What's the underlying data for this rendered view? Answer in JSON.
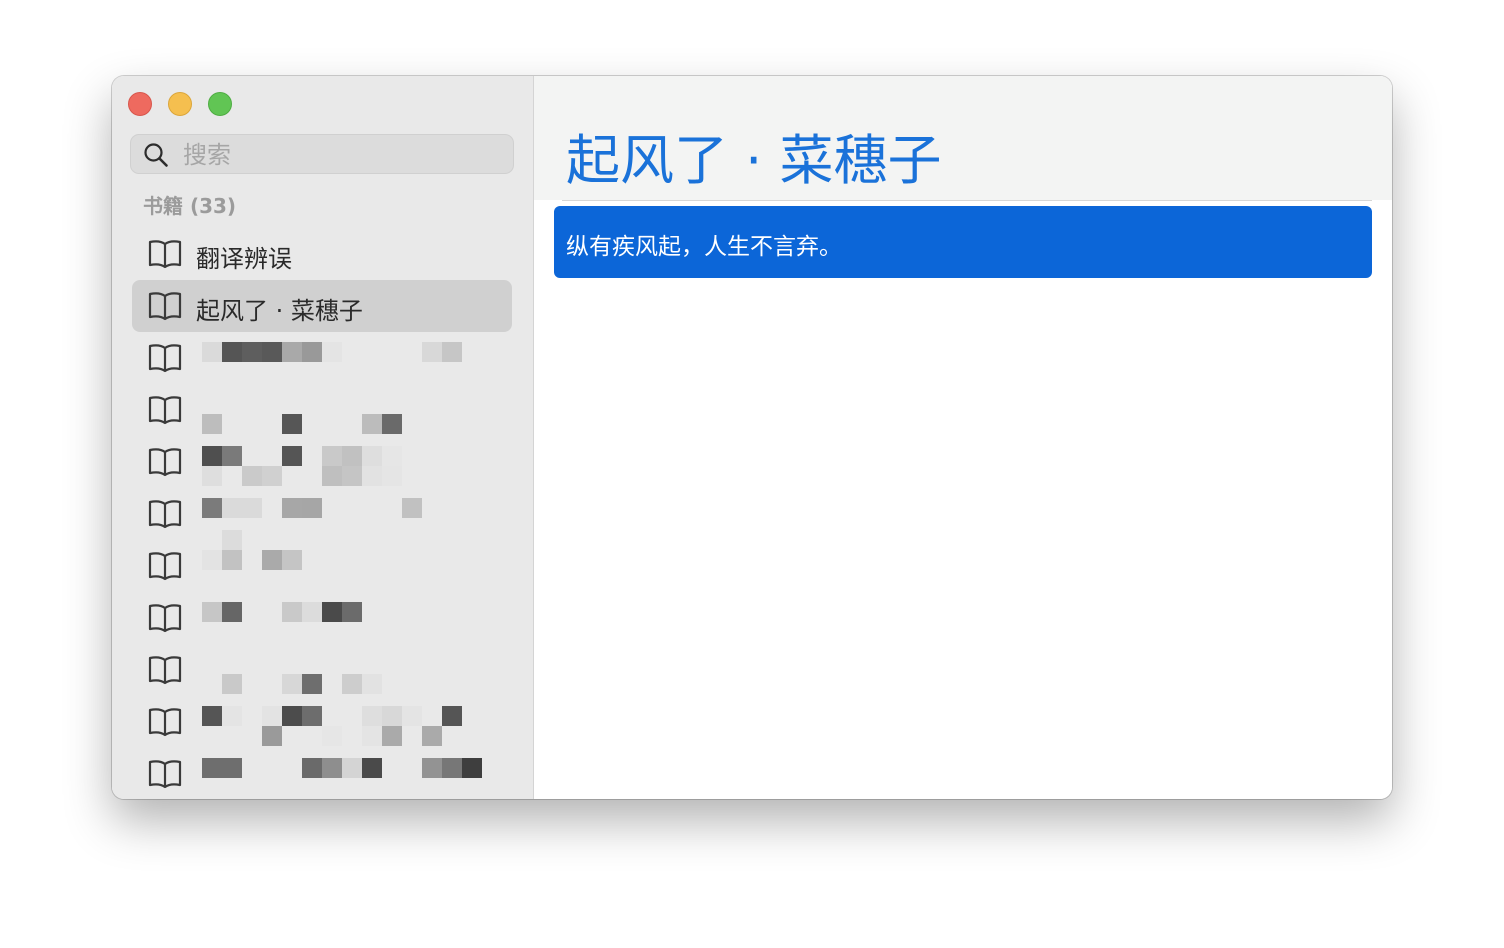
{
  "window": {
    "controls": [
      "close",
      "minimize",
      "maximize"
    ]
  },
  "sidebar": {
    "search": {
      "placeholder": "搜索",
      "value": ""
    },
    "section_header": "书籍 (33)",
    "books": [
      {
        "label": "翻译辨误",
        "icon": "book-icon",
        "selected": false
      },
      {
        "label": "起风了 · 菜穗子",
        "icon": "book-icon",
        "selected": true
      }
    ],
    "redacted_count": 9
  },
  "main": {
    "title": "起风了 · 菜穗子",
    "quotes": [
      {
        "text": "纵有疾风起，人生不言弃。",
        "selected": true
      }
    ]
  },
  "colors": {
    "accent": "#1a72d9",
    "selection": "#0c66d8",
    "sidebar_bg": "#e9e9e9",
    "selected_item_bg": "#d0d0d0"
  }
}
